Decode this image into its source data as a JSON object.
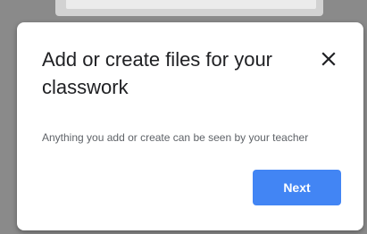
{
  "dialog": {
    "title": "Add or create files for your classwork",
    "description": "Anything you add or create can be seen by your teacher",
    "next_label": "Next",
    "close_icon": "close-icon"
  },
  "colors": {
    "primary_button": "#4285f4",
    "title_text": "#202124",
    "description_text": "#5f6368",
    "overlay": "#8a8a8a"
  }
}
